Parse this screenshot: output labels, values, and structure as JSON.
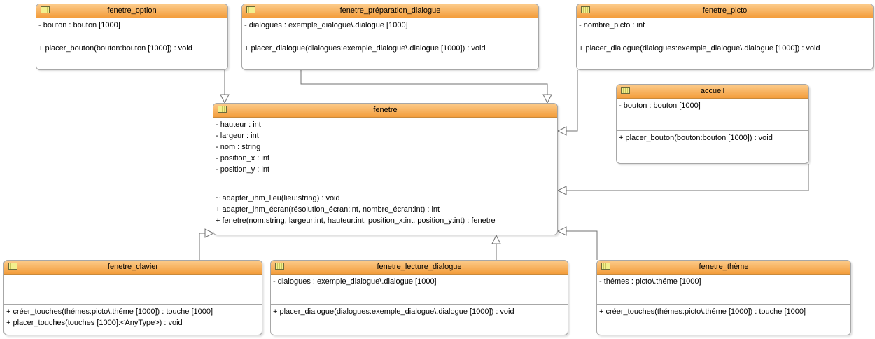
{
  "diagram": {
    "classes": {
      "fenetre_option": {
        "name": "fenetre_option",
        "attributes": [
          "- bouton : bouton [1000]"
        ],
        "operations": [
          "+ placer_bouton(bouton:bouton [1000]) : void"
        ]
      },
      "fenetre_preparation_dialogue": {
        "name": "fenetre_préparation_dialogue",
        "attributes": [
          "- dialogues : exemple_dialogue\\.dialogue [1000]"
        ],
        "operations": [
          "+ placer_dialogue(dialogues:exemple_dialogue\\.dialogue [1000]) : void"
        ]
      },
      "fenetre_picto": {
        "name": "fenetre_picto",
        "attributes": [
          "- nombre_picto : int"
        ],
        "operations": [
          "+ placer_dialogue(dialogues:exemple_dialogue\\.dialogue [1000]) : void"
        ]
      },
      "accueil": {
        "name": "accueil",
        "attributes": [
          "- bouton : bouton [1000]"
        ],
        "operations": [
          "+ placer_bouton(bouton:bouton [1000]) : void"
        ]
      },
      "fenetre": {
        "name": "fenetre",
        "attributes": [
          "- hauteur : int",
          "- largeur : int",
          "- nom : string",
          "- position_x : int",
          "- position_y : int"
        ],
        "operations": [
          "~ adapter_ihm_lieu(lieu:string) : void",
          "+ adapter_ihm_écran(résolution_écran:int, nombre_écran:int) : int",
          "+ fenetre(nom:string, largeur:int, hauteur:int, position_x:int, position_y:int) : fenetre"
        ]
      },
      "fenetre_clavier": {
        "name": "fenetre_clavier",
        "attributes": [],
        "operations": [
          "+ créer_touches(thémes:picto\\.théme [1000]) : touche [1000]",
          "+ placer_touches(touches [1000]:<AnyType>) : void"
        ]
      },
      "fenetre_lecture_dialogue": {
        "name": "fenetre_lecture_dialogue",
        "attributes": [
          "- dialogues : exemple_dialogue\\.dialogue [1000]"
        ],
        "operations": [
          "+ placer_dialogue(dialogues:exemple_dialogue\\.dialogue [1000]) : void"
        ]
      },
      "fenetre_theme": {
        "name": "fenetre_thème",
        "attributes": [
          "- thémes : picto\\.théme [1000]"
        ],
        "operations": [
          "+ créer_touches(thémes:picto\\.théme [1000]) : touche [1000]"
        ]
      }
    },
    "generalizations": [
      {
        "from": "fenetre_option",
        "to": "fenetre"
      },
      {
        "from": "fenetre_préparation_dialogue",
        "to": "fenetre"
      },
      {
        "from": "fenetre_picto",
        "to": "fenetre"
      },
      {
        "from": "accueil",
        "to": "fenetre"
      },
      {
        "from": "fenetre_clavier",
        "to": "fenetre"
      },
      {
        "from": "fenetre_lecture_dialogue",
        "to": "fenetre"
      },
      {
        "from": "fenetre_thème",
        "to": "fenetre"
      }
    ],
    "colors": {
      "header_top": "#fccb8a",
      "header_bottom": "#f39d3c",
      "border": "#a7a7a7",
      "edge": "#707070"
    },
    "icons": {
      "class": "uml-class-icon"
    }
  }
}
